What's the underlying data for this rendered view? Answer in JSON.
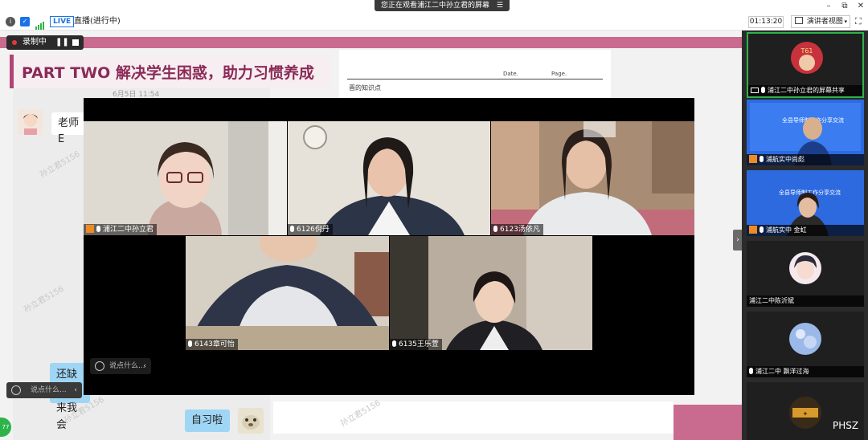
{
  "window": {
    "title": "您正在观看浦江二中孙立君的屏幕",
    "menu_glyph": "☰",
    "minimize": "–",
    "restore": "⧉",
    "close": "✕"
  },
  "toolbar": {
    "info_icon": "i",
    "shield_icon": "✓",
    "live_label": "LIVE",
    "live_status": "直播(进行中)",
    "timer": "01:13:20",
    "view_mode": "演讲者视图",
    "view_chevron": "▾",
    "fullscreen_icon": "⛶"
  },
  "recording": {
    "label": "录制中",
    "pause_icon": "❚❚"
  },
  "slide": {
    "title": "PART TWO 解决学生困惑，助力习惯养成",
    "paper_date": "Date.",
    "paper_page": "Page.",
    "paper_scribble": "晋的知识点"
  },
  "chat": {
    "messages": [
      {
        "text": "老师E"
      },
      {
        "text": "还缺2"
      },
      {
        "text": "来我会"
      },
      {
        "text": "自习啦"
      }
    ],
    "header_fragment": "6月5日  11:54",
    "watermark": "孙立君5156",
    "input_placeholder": "说点什么...",
    "input_chevron": "‹"
  },
  "video": {
    "input_placeholder": "说点什么...",
    "input_chevron": "‹",
    "participants": [
      {
        "name": "浦江二中孙立君",
        "host": true
      },
      {
        "name": "6126倪丹",
        "host": false
      },
      {
        "name": "6123汤依凡",
        "host": false
      },
      {
        "name": "6143章可怡",
        "host": false
      },
      {
        "name": "6135王乐萱",
        "host": false
      }
    ]
  },
  "sidebar": {
    "collapse_icon": "›",
    "brand": "PHSZ",
    "avatar_text": "T61",
    "slide_text_a": "全县导师制工作分享交流",
    "slide_text_b": "全县导师制工作分享交流",
    "tiles": [
      {
        "name": "浦江二中孙立君的屏幕共享"
      },
      {
        "name": "浦航实中尚彪"
      },
      {
        "name": "浦航实中 金虹"
      },
      {
        "name": "浦江二中陈沂斌"
      },
      {
        "name": "浦江二中  飘洋过海"
      },
      {
        "name": ""
      }
    ]
  },
  "badge": {
    "count": "77"
  },
  "colors": {
    "accent_pink": "#c96b8e",
    "slide_title": "#8a2b57",
    "live_blue": "#1a73e8",
    "record_red": "#e53935",
    "sidebar_dark": "#2b2b2b",
    "badge_green": "#2db34a"
  }
}
